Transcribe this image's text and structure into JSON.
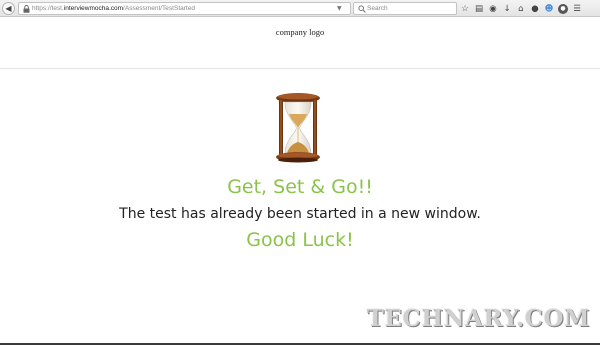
{
  "browser": {
    "url_prefix": "https://test.",
    "url_host": "interviewmocha.com",
    "url_path": "/Assessment/TestStarted",
    "search_placeholder": "Search",
    "icons": [
      "back-arrow-icon",
      "lock-icon",
      "dropdown-arrow-icon",
      "reload-icon",
      "search-icon",
      "bookmark-star-icon",
      "reading-list-icon",
      "pocket-icon",
      "download-icon",
      "home-icon",
      "chat-icon",
      "account-icon",
      "extension-icon",
      "menu-icon"
    ]
  },
  "page": {
    "logo_text": "company logo",
    "heading": "Get, Set & Go!!",
    "message": "The test has already been started in a new window.",
    "closing": "Good Luck!"
  },
  "watermark": {
    "text": "TECHNARY.COM"
  },
  "colors": {
    "accent_green": "#8bc34a",
    "text_dark": "#222222",
    "toolbar_bg": "#e8e8e8",
    "hourglass_wood": "#7a3b14",
    "hourglass_sand": "#d9a85a"
  }
}
